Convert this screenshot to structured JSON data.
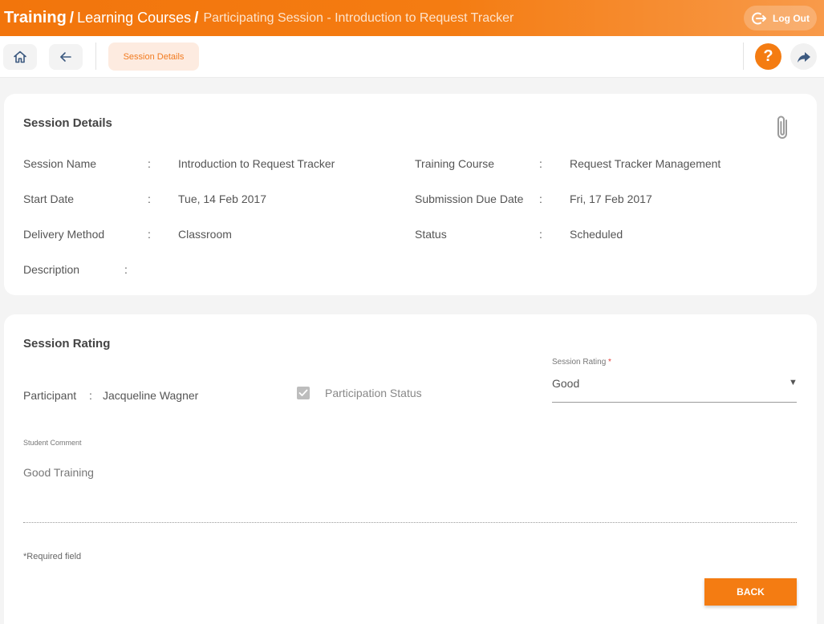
{
  "header": {
    "crumb_root": "Training",
    "crumb_sep1": "/",
    "crumb_mid": "Learning Courses",
    "crumb_sep2": "/",
    "crumb_current": "Participating Session - Introduction to Request Tracker",
    "logout_label": "Log Out"
  },
  "toolbar": {
    "home_icon": "home-icon",
    "back_icon": "arrow-left-icon",
    "tab_label": "Session Details",
    "help_glyph": "?",
    "share_icon": "share-icon"
  },
  "session_details": {
    "title": "Session Details",
    "attach_icon": "paperclip-icon",
    "fields": {
      "session_name": {
        "label": "Session Name",
        "value": "Introduction to Request Tracker"
      },
      "training_course": {
        "label": "Training Course",
        "value": "Request Tracker Management"
      },
      "start_date": {
        "label": "Start Date",
        "value": "Tue, 14 Feb 2017"
      },
      "submission_due_date": {
        "label": "Submission Due Date",
        "value": "Fri, 17 Feb 2017"
      },
      "delivery_method": {
        "label": "Delivery Method",
        "value": "Classroom"
      },
      "status": {
        "label": "Status",
        "value": "Scheduled"
      },
      "description": {
        "label": "Description",
        "value": ""
      }
    },
    "colon": ":"
  },
  "session_rating": {
    "title": "Session Rating",
    "participant_label": "Participant",
    "participant_value": "Jacqueline Wagner",
    "participation_status_label": "Participation Status",
    "participation_status_checked": true,
    "rating_label": "Session Rating",
    "rating_required_mark": "*",
    "rating_value": "Good",
    "rating_arrow": "▼",
    "comment_label": "Student Comment",
    "comment_value": "Good Training",
    "required_note_mark": "*",
    "required_note": "Required field",
    "back_button": "BACK"
  },
  "colors": {
    "accent": "#f47c12",
    "chip_bg": "#fdebe0",
    "page_bg": "#f4f4f4"
  }
}
